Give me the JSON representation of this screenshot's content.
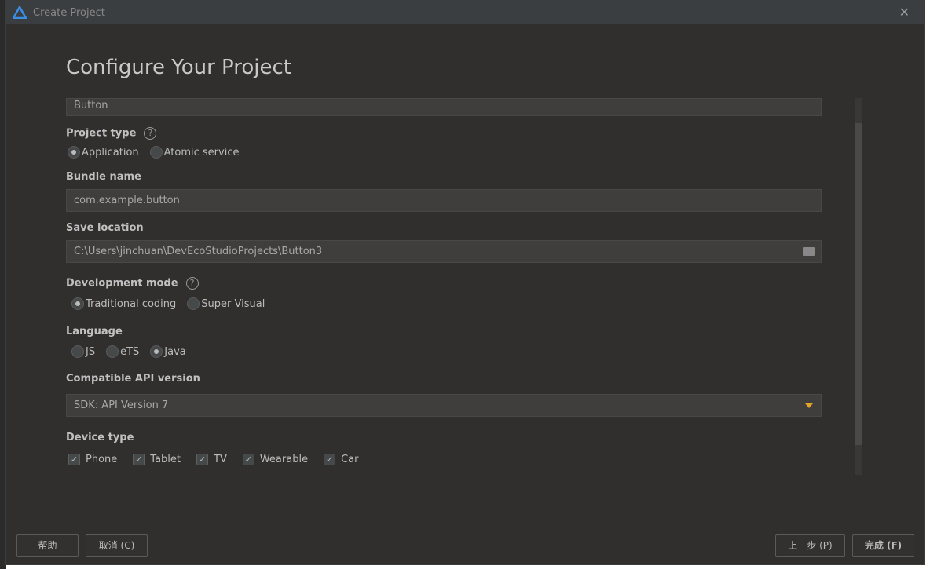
{
  "window": {
    "title": "Create Project",
    "close": "✕"
  },
  "page_title": "Configure Your Project",
  "project_name": {
    "value": "Button"
  },
  "project_type": {
    "label": "Project type",
    "help": "?",
    "options": [
      {
        "label": "Application",
        "selected": true
      },
      {
        "label": "Atomic service",
        "selected": false
      }
    ]
  },
  "bundle_name": {
    "label": "Bundle name",
    "value": "com.example.button"
  },
  "save_location": {
    "label": "Save location",
    "value": "C:\\Users\\jinchuan\\DevEcoStudioProjects\\Button3",
    "icon": "folder-icon"
  },
  "development_mode": {
    "label": "Development mode",
    "help": "?",
    "options": [
      {
        "label": "Traditional coding",
        "selected": true
      },
      {
        "label": "Super Visual",
        "selected": false
      }
    ]
  },
  "language": {
    "label": "Language",
    "options": [
      {
        "label": "JS",
        "selected": false
      },
      {
        "label": "eTS",
        "selected": false
      },
      {
        "label": "Java",
        "selected": true
      }
    ]
  },
  "api_version": {
    "label": "Compatible API version",
    "value": "SDK: API Version 7",
    "accent": "#e0a32c"
  },
  "device_type": {
    "label": "Device type",
    "options": [
      {
        "label": "Phone",
        "checked": true
      },
      {
        "label": "Tablet",
        "checked": true
      },
      {
        "label": "TV",
        "checked": true
      },
      {
        "label": "Wearable",
        "checked": true
      },
      {
        "label": "Car",
        "checked": true
      }
    ]
  },
  "buttons": {
    "help": "帮助",
    "cancel": "取消 (C)",
    "previous": "上一步 (P)",
    "finish": "完成 (F)"
  }
}
